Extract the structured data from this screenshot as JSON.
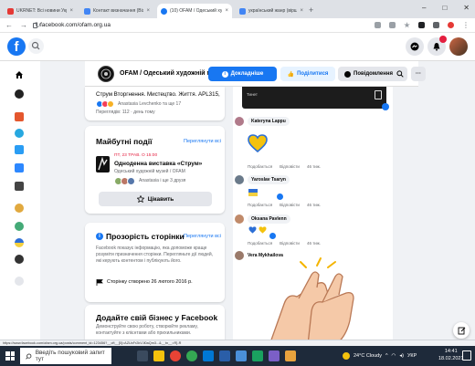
{
  "browser": {
    "tabs": [
      {
        "title": "UKRNET: Всі новини України, п",
        "favicon_color": "#e53935",
        "active": false
      },
      {
        "title": "Контакт визначання (Візди конт",
        "favicon_color": "#4285f4",
        "active": false
      },
      {
        "title": "(10) OFAM / Одеський художні м",
        "favicon_color": "#1877f2",
        "active": true
      },
      {
        "title": "український жанр (вірш) - Пош",
        "favicon_color": "#4285f4",
        "active": false
      }
    ],
    "new_tab": "+",
    "window_controls": [
      "–",
      "□",
      "✕"
    ],
    "url": "facebook.com/ofam.org.ua"
  },
  "page_header": {
    "page_name": "OFAM / Одеський художній музей",
    "details_label": "Докладніше",
    "share_label": "Поділитися",
    "notify_label": "Повідомлення",
    "more_label": "···"
  },
  "top_card": {
    "title": "Струм Вторгнення. Мистецтво. Життя. APL315, ...",
    "reacted_by": "Anastasia Levchenko та ще 17",
    "meta": "Переглядів: 112 · день тому"
  },
  "events": {
    "heading": "Майбутні події",
    "see_all": "Переглянути всі",
    "date": "ПТ, 23 ТРАВ. О 15:00",
    "title": "Одноденна виставка «Струм»",
    "place": "Одеський художній музей / OFAM",
    "going": "Anastasia і ще 3 друзя",
    "interested_label": "Цікавить"
  },
  "transparency": {
    "heading": "Прозорість сторінки",
    "see_all": "Переглянути всі",
    "description": "Facebook показує інформацію, яка допоможе краще розуміти призначення сторінки. Перегляньте дії людей, які керують контентом і публікують його.",
    "created": "Сторінку створено 26 лютого 2016 р."
  },
  "business": {
    "heading": "Додайте свій бізнес у Facebook",
    "description": "Демонструйте свою роботу, створюйте рекламу, контактуйте з клієнтами або прихильниками."
  },
  "feed": {
    "video_label": "Тинет",
    "comments": [
      {
        "name": "Kateryna Lappu",
        "actions": [
          "Подобається",
          "Відповісти",
          "46 тиж."
        ],
        "avatar_color": "#b07a8a"
      },
      {
        "name": "Yaroslav Tsaryn",
        "actions": [
          "Подобається",
          "Відповісти",
          "46 тиж."
        ],
        "avatar_color": "#6a7a8a"
      },
      {
        "name": "Oksana Pavlenn",
        "actions": [
          "Подобається",
          "Відповісти",
          "46 тиж."
        ],
        "avatar_color": "#c08a6a"
      },
      {
        "name": "Vera Mykhailova",
        "actions": [],
        "avatar_color": "#9a7a6a"
      }
    ]
  },
  "status_url": "https://www.facebook.com/ofam.org.ua/posts/comment_id=123456?__cft__[0]=AZUxFr2kVJi0aQm3...&__tn__=R]-R",
  "taskbar": {
    "search_placeholder": "Введіть пошуковий запит тут",
    "weather": "24°C Cloudy",
    "lang": "УКР",
    "time": "14:41",
    "date": "18.02.2021"
  },
  "colors": {
    "fb_blue": "#1877f2",
    "taskbar": "#1e2a3a"
  }
}
